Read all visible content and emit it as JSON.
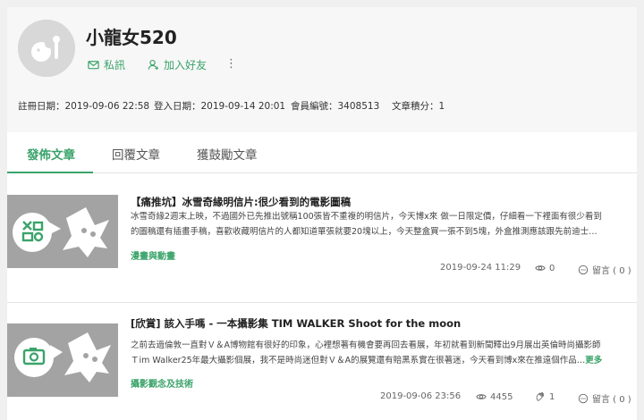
{
  "profile": {
    "username": "小龍女520",
    "actions": {
      "message": "私訊",
      "add_friend": "加入好友"
    },
    "more_label": "⋮",
    "stats": {
      "registered": "註冊日期：2019-09-06 22:58",
      "last_login": "登入日期：2019-09-14 20:01",
      "member_id": "會員編號：3408513",
      "article_points": "文章積分：1"
    }
  },
  "tabs": [
    {
      "label": "發佈文章",
      "active": true
    },
    {
      "label": "回覆文章",
      "active": false
    },
    {
      "label": "獲鼓勵文章",
      "active": false
    }
  ],
  "posts": [
    {
      "title": "【痛推坑】冰雪奇緣明信片:很少看到的電影圖稿",
      "excerpt_line1": "冰雪奇緣2週末上映，不過國外已先推出號稱100張皆不重複的明信片，今天博x來 做一日限定價，仔細看一下裡面有很少看到",
      "excerpt_line2": "的圖稿還有插畫手稿，喜歡收藏明信片的人都知道單張就要20塊以上，今天整盒買一張不到5塊，外盒推測應該跟先前迪士…",
      "category": "漫畫與動畫",
      "date": "2019-09-24 11:29",
      "views": "0",
      "comments": "留言 ( 0 )"
    },
    {
      "title": "[欣賞] 該入手嗎 - 一本攝影集 TIM WALKER Shoot for the moon",
      "excerpt_line1": "之前去過倫敦一直對Ｖ＆A博物館有很好的印象，心裡想著有機會要再回去看展，年初就看到新聞釋出9月展出英倫時尚攝影師",
      "excerpt_line2": "Ｔim Walker25年最大攝影個展，我不是時尚迷但對Ｖ＆A的展覽還有賠黑系實在很著迷，今天看到博x來在推遠個作品…",
      "more_label": "更多",
      "category": "攝影觀念及技術",
      "date": "2019-09-06 23:56",
      "views": "4455",
      "likes": "1",
      "comments": "留言 ( 0 )"
    }
  ],
  "colors": {
    "accent": "#3aa36a",
    "header_bg": "#f7f7f7",
    "thumb_bg": "#a3a3a3"
  },
  "icons": [
    "avatar-placeholder-icon",
    "mail-icon",
    "user-add-icon",
    "more-vertical-icon",
    "eye-icon",
    "clap-icon",
    "comment-icon",
    "toys-icon",
    "camera-icon"
  ]
}
